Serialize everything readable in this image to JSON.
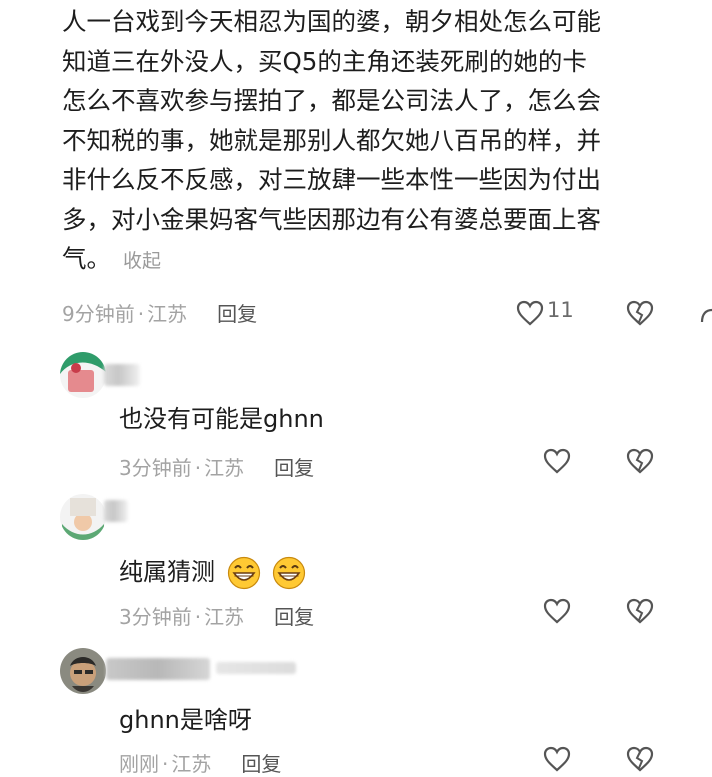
{
  "main_comment": {
    "lines": [
      "人一台戏到今天相忍为国的婆，朝夕相处怎么可能",
      "知道三在外没人，买Q5的主角还装死刷的她的卡",
      "怎么不喜欢参与摆拍了，都是公司法人了，怎么会",
      "不知税的事，她就是那别人都欠她八百吊的样，并",
      "非什么反不反感，对三放肆一些本性一些因为付出",
      "多，对小金果妈客气些因那边有公有婆总要面上客",
      "气。"
    ],
    "collapse_label": "收起",
    "time": "9分钟前",
    "location": "江苏",
    "reply_label": "回复",
    "like_count": "11"
  },
  "replies": [
    {
      "text": "也没有可能是ghnn",
      "time": "3分钟前",
      "location": "江苏",
      "reply_label": "回复"
    },
    {
      "text": "纯属猜测",
      "emoji": [
        "grin-emoji",
        "grin-emoji"
      ],
      "time": "3分钟前",
      "location": "江苏",
      "reply_label": "回复"
    },
    {
      "text": "ghnn是啥呀",
      "time": "刚刚",
      "location": "江苏",
      "reply_label": "回复"
    }
  ],
  "separator": "·",
  "colors": {
    "meta": "#a3a3a3",
    "text": "#1d1d1d",
    "icon": "#555555"
  }
}
